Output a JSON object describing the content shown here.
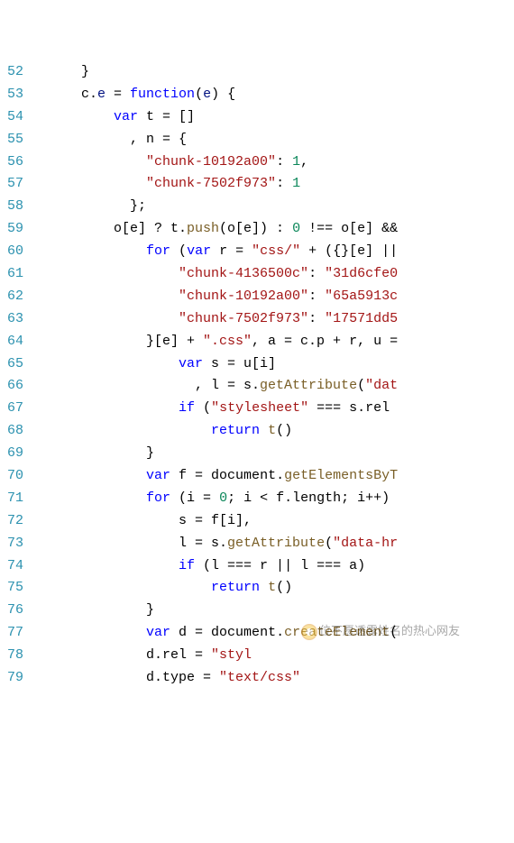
{
  "gutter_start": 52,
  "lines": [
    [
      {
        "t": "      }",
        "c": "pn"
      }
    ],
    [
      {
        "t": "      c.",
        "c": "ident"
      },
      {
        "t": "e",
        "c": "obj"
      },
      {
        "t": " = ",
        "c": "pn"
      },
      {
        "t": "function",
        "c": "kw"
      },
      {
        "t": "(",
        "c": "pn"
      },
      {
        "t": "e",
        "c": "obj"
      },
      {
        "t": ") {",
        "c": "pn"
      }
    ],
    [
      {
        "t": "          ",
        "c": "pn"
      },
      {
        "t": "var",
        "c": "kw"
      },
      {
        "t": " t = []",
        "c": "ident"
      }
    ],
    [
      {
        "t": "            , n = {",
        "c": "ident"
      }
    ],
    [
      {
        "t": "              ",
        "c": "pn"
      },
      {
        "t": "\"chunk-10192a00\"",
        "c": "str"
      },
      {
        "t": ": ",
        "c": "pn"
      },
      {
        "t": "1",
        "c": "num"
      },
      {
        "t": ",",
        "c": "pn"
      }
    ],
    [
      {
        "t": "              ",
        "c": "pn"
      },
      {
        "t": "\"chunk-7502f973\"",
        "c": "str"
      },
      {
        "t": ": ",
        "c": "pn"
      },
      {
        "t": "1",
        "c": "num"
      }
    ],
    [
      {
        "t": "            };",
        "c": "pn"
      }
    ],
    [
      {
        "t": "          o[e] ? t.",
        "c": "ident"
      },
      {
        "t": "push",
        "c": "fn"
      },
      {
        "t": "(o[e]) : ",
        "c": "ident"
      },
      {
        "t": "0",
        "c": "num"
      },
      {
        "t": " !== o[e] &&",
        "c": "ident"
      }
    ],
    [
      {
        "t": "              ",
        "c": "pn"
      },
      {
        "t": "for",
        "c": "kw"
      },
      {
        "t": " (",
        "c": "pn"
      },
      {
        "t": "var",
        "c": "kw"
      },
      {
        "t": " r = ",
        "c": "ident"
      },
      {
        "t": "\"css/\"",
        "c": "str"
      },
      {
        "t": " + ({}[e] ||",
        "c": "ident"
      }
    ],
    [
      {
        "t": "                  ",
        "c": "pn"
      },
      {
        "t": "\"chunk-4136500c\"",
        "c": "str"
      },
      {
        "t": ": ",
        "c": "pn"
      },
      {
        "t": "\"31d6cfe0",
        "c": "str"
      }
    ],
    [
      {
        "t": "                  ",
        "c": "pn"
      },
      {
        "t": "\"chunk-10192a00\"",
        "c": "str"
      },
      {
        "t": ": ",
        "c": "pn"
      },
      {
        "t": "\"65a5913c",
        "c": "str"
      }
    ],
    [
      {
        "t": "                  ",
        "c": "pn"
      },
      {
        "t": "\"chunk-7502f973\"",
        "c": "str"
      },
      {
        "t": ": ",
        "c": "pn"
      },
      {
        "t": "\"17571dd5",
        "c": "str"
      }
    ],
    [
      {
        "t": "              }[e] + ",
        "c": "ident"
      },
      {
        "t": "\".css\"",
        "c": "str"
      },
      {
        "t": ", a = c.p + r, u =",
        "c": "ident"
      }
    ],
    [
      {
        "t": "                  ",
        "c": "pn"
      },
      {
        "t": "var",
        "c": "kw"
      },
      {
        "t": " s = u[i]",
        "c": "ident"
      }
    ],
    [
      {
        "t": "                    , l = s.",
        "c": "ident"
      },
      {
        "t": "getAttribute",
        "c": "fn"
      },
      {
        "t": "(",
        "c": "pn"
      },
      {
        "t": "\"dat",
        "c": "str"
      }
    ],
    [
      {
        "t": "                  ",
        "c": "pn"
      },
      {
        "t": "if",
        "c": "kw"
      },
      {
        "t": " (",
        "c": "pn"
      },
      {
        "t": "\"stylesheet\"",
        "c": "str"
      },
      {
        "t": " === s.rel ",
        "c": "ident"
      }
    ],
    [
      {
        "t": "                      ",
        "c": "pn"
      },
      {
        "t": "return",
        "c": "kw"
      },
      {
        "t": " ",
        "c": "pn"
      },
      {
        "t": "t",
        "c": "fn"
      },
      {
        "t": "()",
        "c": "pn"
      }
    ],
    [
      {
        "t": "              }",
        "c": "pn"
      }
    ],
    [
      {
        "t": "              ",
        "c": "pn"
      },
      {
        "t": "var",
        "c": "kw"
      },
      {
        "t": " f = document.",
        "c": "ident"
      },
      {
        "t": "getElementsByT",
        "c": "fn"
      }
    ],
    [
      {
        "t": "              ",
        "c": "pn"
      },
      {
        "t": "for",
        "c": "kw"
      },
      {
        "t": " (i = ",
        "c": "ident"
      },
      {
        "t": "0",
        "c": "num"
      },
      {
        "t": "; i < f.length; i++) ",
        "c": "ident"
      }
    ],
    [
      {
        "t": "                  s = f[i],",
        "c": "ident"
      }
    ],
    [
      {
        "t": "                  l = s.",
        "c": "ident"
      },
      {
        "t": "getAttribute",
        "c": "fn"
      },
      {
        "t": "(",
        "c": "pn"
      },
      {
        "t": "\"data-hr",
        "c": "str"
      }
    ],
    [
      {
        "t": "                  ",
        "c": "pn"
      },
      {
        "t": "if",
        "c": "kw"
      },
      {
        "t": " (l === r || l === a)",
        "c": "ident"
      }
    ],
    [
      {
        "t": "                      ",
        "c": "pn"
      },
      {
        "t": "return",
        "c": "kw"
      },
      {
        "t": " ",
        "c": "pn"
      },
      {
        "t": "t",
        "c": "fn"
      },
      {
        "t": "()",
        "c": "pn"
      }
    ],
    [
      {
        "t": "              }",
        "c": "pn"
      }
    ],
    [
      {
        "t": "              ",
        "c": "pn"
      },
      {
        "t": "var",
        "c": "kw"
      },
      {
        "t": " d = document.",
        "c": "ident"
      },
      {
        "t": "createElement",
        "c": "fn"
      },
      {
        "t": "(",
        "c": "pn"
      }
    ],
    [
      {
        "t": "              d.rel = ",
        "c": "ident"
      },
      {
        "t": "\"styl",
        "c": "str"
      }
    ],
    [
      {
        "t": "              d.type = ",
        "c": "ident"
      },
      {
        "t": "\"text/css\"",
        "c": "str"
      }
    ]
  ],
  "watermark": "位不愿透露姓名的热心网友"
}
